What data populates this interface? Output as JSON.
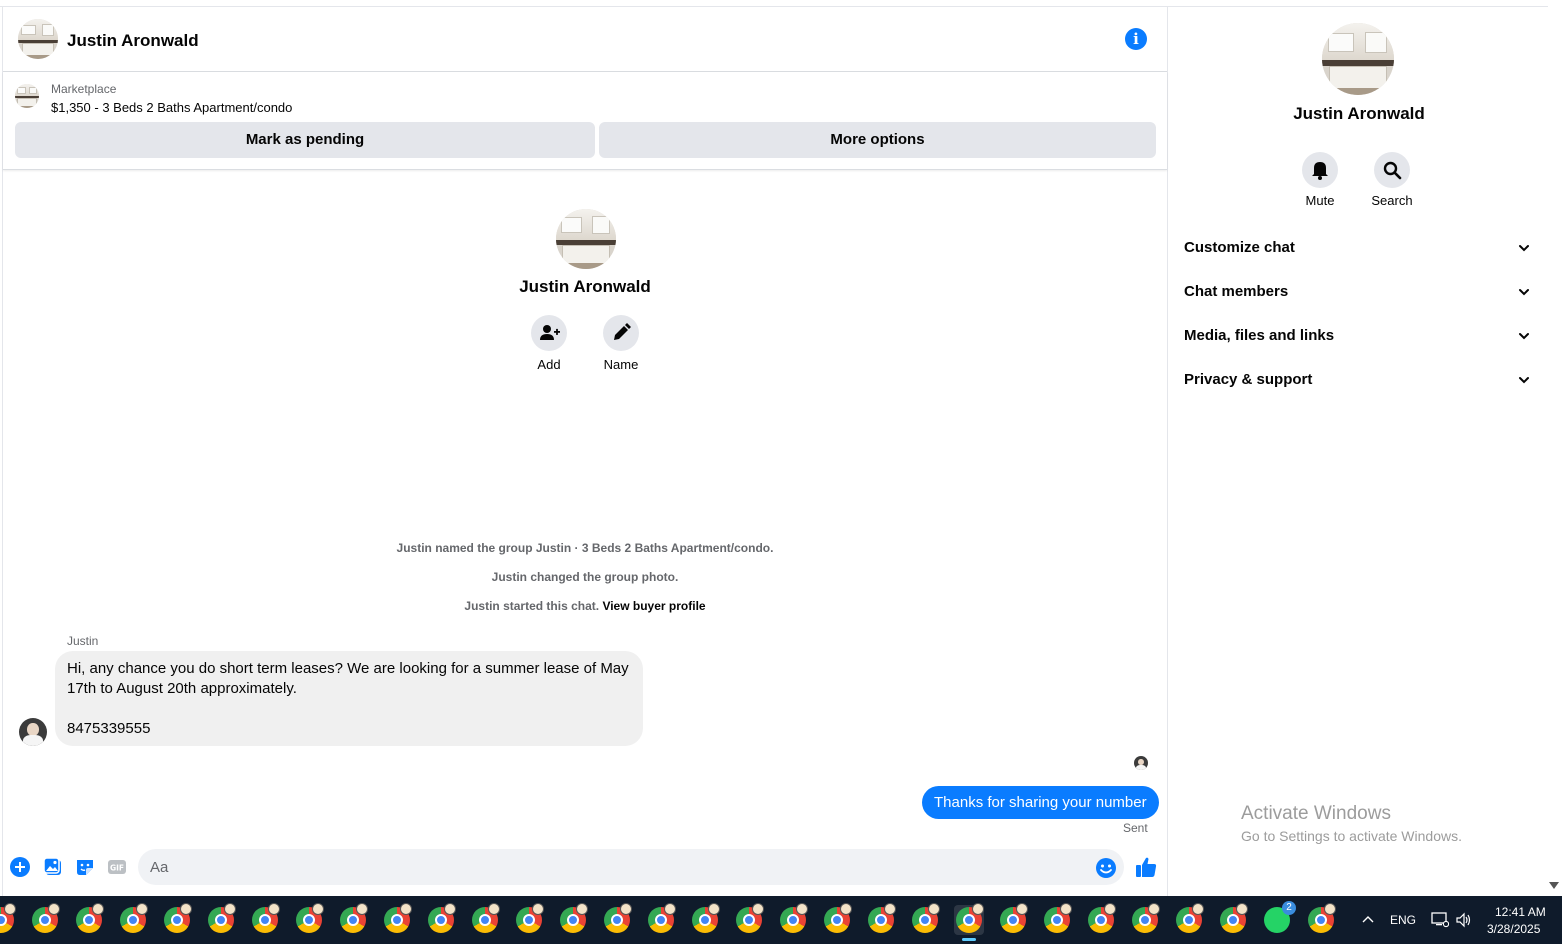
{
  "header": {
    "name": "Justin Aronwald",
    "info_icon": "info-icon"
  },
  "listing": {
    "label": "Marketplace",
    "title": "$1,350 - 3 Beds 2 Baths Apartment/condo",
    "pending_button": "Mark as pending",
    "more_button": "More options"
  },
  "intro": {
    "name": "Justin Aronwald",
    "add_label": "Add",
    "name_label": "Name"
  },
  "system_messages": {
    "named": "Justin named the group Justin · 3 Beds 2 Baths Apartment/condo.",
    "photo": "Justin changed the group photo.",
    "started": "Justin started this chat.",
    "view_profile": "View buyer profile"
  },
  "messages": {
    "incoming_sender": "Justin",
    "incoming_line1": "Hi, any chance you do short term leases? We are looking for a summer lease of May",
    "incoming_line2": "17th to August 20th approximately.",
    "incoming_line3": "8475339555",
    "outgoing_text": "Thanks for sharing your number",
    "outgoing_status": "Sent"
  },
  "composer": {
    "placeholder": "Aa",
    "icons": [
      "plus-icon",
      "photo-icon",
      "sticker-icon",
      "gif-icon",
      "emoji-icon",
      "thumbs-up-icon"
    ],
    "gif_label": "GIF"
  },
  "sidebar": {
    "name": "Justin Aronwald",
    "mute_label": "Mute",
    "search_label": "Search",
    "sections": [
      "Customize chat",
      "Chat members",
      "Media, files and links",
      "Privacy & support"
    ]
  },
  "watermark": {
    "title": "Activate Windows",
    "subtitle": "Go to Settings to activate Windows."
  },
  "taskbar": {
    "whatsapp_badge": "2",
    "language": "ENG",
    "time": "12:41 AM",
    "date": "3/28/2025"
  },
  "colors": {
    "accent": "#0a7cff",
    "bubble_in": "#f0f0f0",
    "button_gray": "#e4e6eb",
    "taskbar": "#0f1b2b"
  }
}
